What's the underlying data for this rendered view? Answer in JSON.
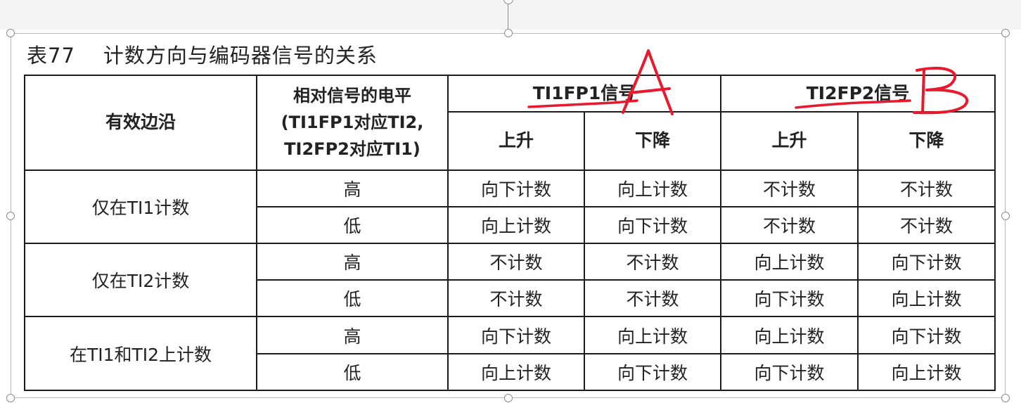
{
  "caption": {
    "number": "表77",
    "title": "计数方向与编码器信号的关系"
  },
  "table": {
    "header": {
      "edge": "有效边沿",
      "level_line1": "相对信号的电平",
      "level_line2": "(TI1FP1对应TI2,",
      "level_line3": "TI2FP2对应TI1)",
      "ti1fp1": "TI1FP1信号",
      "ti2fp2": "TI2FP2信号",
      "rise": "上升",
      "fall": "下降"
    },
    "groups": [
      {
        "edge": "仅在TI1计数",
        "rows": [
          {
            "level": "高",
            "cells": [
              "向下计数",
              "向上计数",
              "不计数",
              "不计数"
            ]
          },
          {
            "level": "低",
            "cells": [
              "向上计数",
              "向下计数",
              "不计数",
              "不计数"
            ]
          }
        ]
      },
      {
        "edge": "仅在TI2计数",
        "rows": [
          {
            "level": "高",
            "cells": [
              "不计数",
              "不计数",
              "向上计数",
              "向下计数"
            ]
          },
          {
            "level": "低",
            "cells": [
              "不计数",
              "不计数",
              "向下计数",
              "向上计数"
            ]
          }
        ]
      },
      {
        "edge": "在TI1和TI2上计数",
        "rows": [
          {
            "level": "高",
            "cells": [
              "向下计数",
              "向上计数",
              "向上计数",
              "向下计数"
            ]
          },
          {
            "level": "低",
            "cells": [
              "向上计数",
              "向下计数",
              "向下计数",
              "向上计数"
            ]
          }
        ]
      }
    ]
  },
  "annotations": {
    "letter_a": "A",
    "letter_b": "B",
    "ink_color": "#e8192c"
  },
  "colors": {
    "border": "#1c1c1c",
    "text": "#222222",
    "handle": "#8c8c8c"
  }
}
